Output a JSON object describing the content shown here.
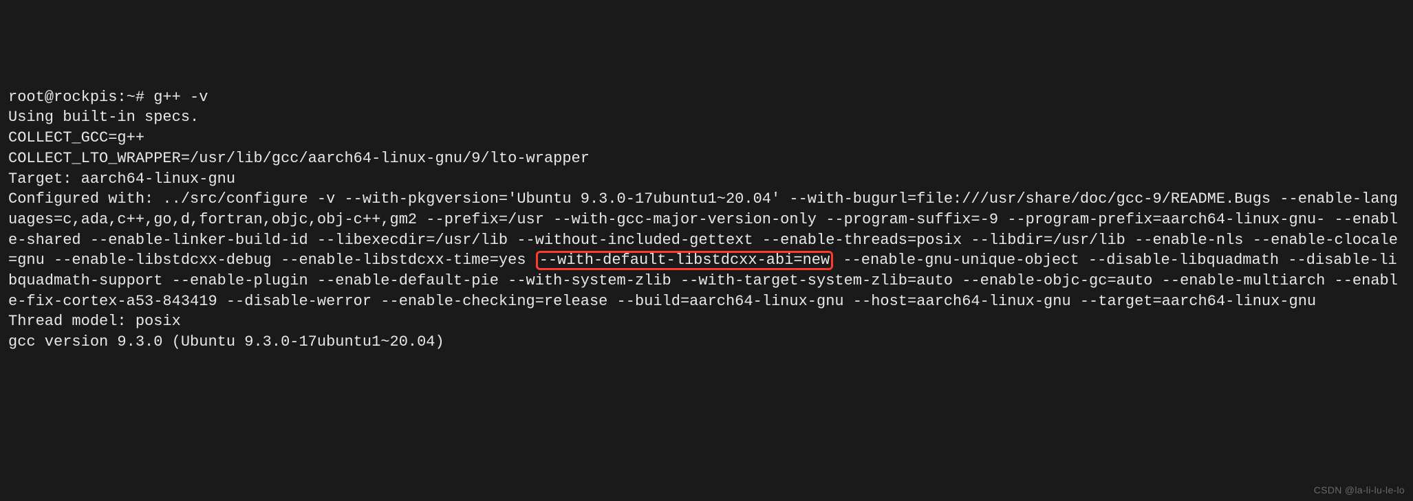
{
  "terminal": {
    "prompt": "root@rockpis:~# ",
    "command": "g++ -v",
    "line1": "Using built-in specs.",
    "line2": "COLLECT_GCC=g++",
    "line3": "COLLECT_LTO_WRAPPER=/usr/lib/gcc/aarch64-linux-gnu/9/lto-wrapper",
    "line4": "Target: aarch64-linux-gnu",
    "config_pre": "Configured with: ../src/configure -v --with-pkgversion='Ubuntu 9.3.0-17ubuntu1~20.04' --with-bugurl=file:///usr/share/doc/gcc-9/README.Bugs --enable-languages=c,ada,c++,go,d,fortran,objc,obj-c++,gm2 --prefix=/usr --with-gcc-major-version-only --program-suffix=-9 --program-prefix=aarch64-linux-gnu- --enable-shared --enable-linker-build-id --libexecdir=/usr/lib --without-included-gettext --enable-threads=posix --libdir=/usr/lib --enable-nls --enable-clocale=gnu --enable-libstdcxx-debug --enable-libstdcxx-time=yes ",
    "config_highlight": "--with-default-libstdcxx-abi=new",
    "config_post": " --enable-gnu-unique-object --disable-libquadmath --disable-libquadmath-support --enable-plugin --enable-default-pie --with-system-zlib --with-target-system-zlib=auto --enable-objc-gc=auto --enable-multiarch --enable-fix-cortex-a53-843419 --disable-werror --enable-checking=release --build=aarch64-linux-gnu --host=aarch64-linux-gnu --target=aarch64-linux-gnu",
    "line_thread": "Thread model: posix",
    "line_version": "gcc version 9.3.0 (Ubuntu 9.3.0-17ubuntu1~20.04)"
  },
  "watermark": "CSDN @la-li-lu-le-lo"
}
